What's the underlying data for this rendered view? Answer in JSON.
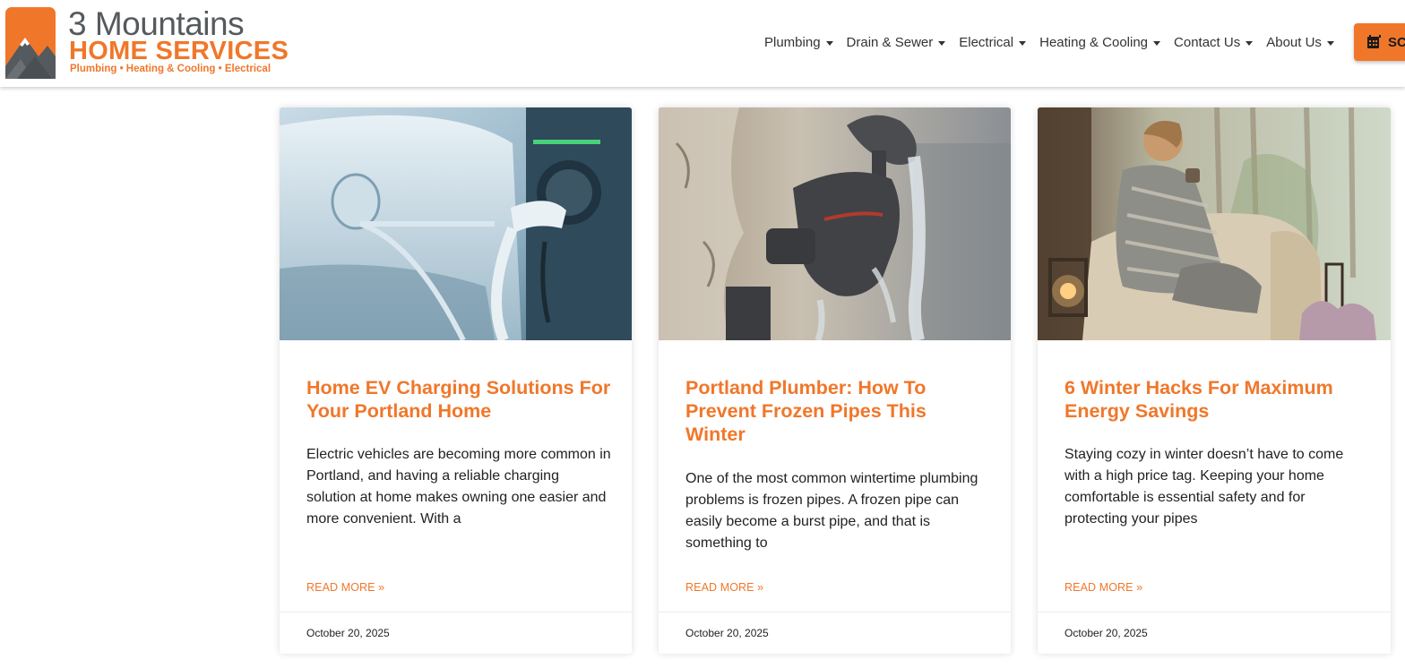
{
  "brand": {
    "name_line1": "3 Mountains",
    "name_line2": "HOME SERVICES",
    "tagline": "Plumbing • Heating & Cooling • Electrical",
    "colors": {
      "accent": "#f0772a",
      "logo_gray": "#555a5e"
    }
  },
  "nav": {
    "items": [
      {
        "label": "Plumbing",
        "icon": "caret-down-icon"
      },
      {
        "label": "Drain & Sewer",
        "icon": "caret-down-icon"
      },
      {
        "label": "Electrical",
        "icon": "caret-down-icon"
      },
      {
        "label": "Heating & Cooling",
        "icon": "caret-down-icon"
      },
      {
        "label": "Contact Us",
        "icon": "caret-down-icon"
      },
      {
        "label": "About Us",
        "icon": "caret-down-icon"
      }
    ],
    "cta_label": "SC",
    "cta_icon": "calendar-icon"
  },
  "posts": [
    {
      "image": "ev-charger-photo",
      "title": "Home EV Charging Solutions For Your Portland Home",
      "excerpt": "Electric vehicles are becoming more common in Portland, and having a reliable charging solution at home makes owning one easier and more convenient. With a",
      "read_more": "READ MORE »",
      "date": "October 20, 2025"
    },
    {
      "image": "frozen-faucet-photo",
      "title": "Portland Plumber: How To Prevent Frozen Pipes This Winter",
      "excerpt": "One of the most common wintertime plumbing problems is frozen pipes. A frozen pipe can easily become a burst pipe, and that is something to",
      "read_more": "READ MORE »",
      "date": "October 20, 2025"
    },
    {
      "image": "cozy-winter-photo",
      "title": "6 Winter Hacks For Maximum Energy Savings",
      "excerpt": "Staying cozy in winter doesn’t have to come with a high price tag. Keeping your home comfortable is essential safety and for protecting your pipes",
      "read_more": "READ MORE »",
      "date": "October 20, 2025"
    }
  ]
}
